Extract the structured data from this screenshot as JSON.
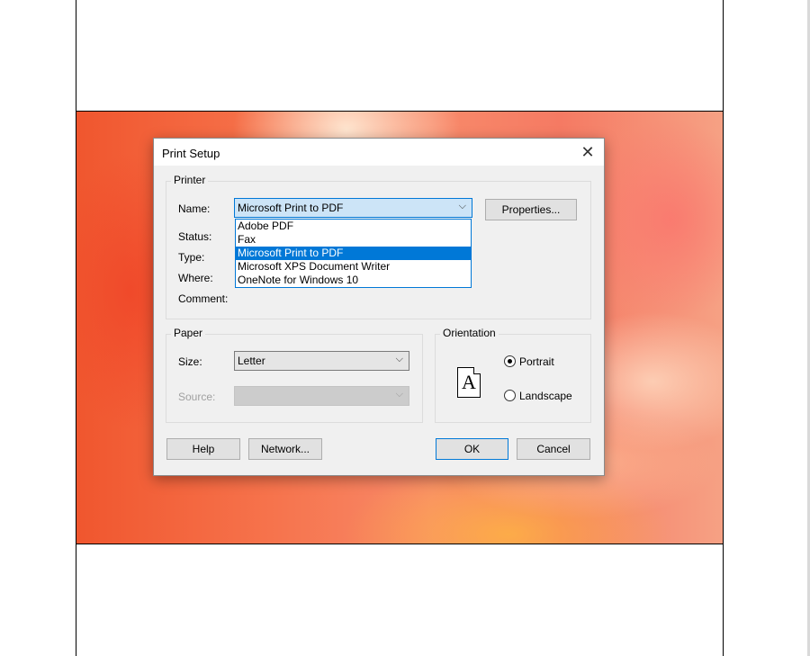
{
  "dialog": {
    "title": "Print Setup",
    "close_glyph": "✕"
  },
  "printer": {
    "group_label": "Printer",
    "name_label": "Name:",
    "name_value": "Microsoft Print to PDF",
    "status_label": "Status:",
    "type_label": "Type:",
    "where_label": "Where:",
    "comment_label": "Comment:",
    "properties_label": "Properties...",
    "options": [
      "Adobe PDF",
      "Fax",
      "Microsoft Print to PDF",
      "Microsoft XPS Document Writer",
      "OneNote for Windows 10"
    ],
    "selected_index": 2
  },
  "paper": {
    "group_label": "Paper",
    "size_label": "Size:",
    "size_value": "Letter",
    "source_label": "Source:",
    "source_value": ""
  },
  "orientation": {
    "group_label": "Orientation",
    "portrait_label": "Portrait",
    "landscape_label": "Landscape",
    "selected": "Portrait",
    "preview_letter": "A"
  },
  "buttons": {
    "help": "Help",
    "network": "Network...",
    "ok": "OK",
    "cancel": "Cancel"
  },
  "colors": {
    "accent": "#0078d7",
    "dialog_bg": "#f0f0f0"
  }
}
